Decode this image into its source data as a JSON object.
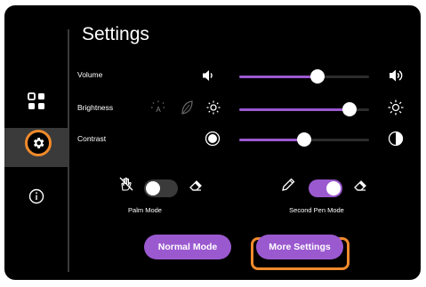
{
  "title": "Settings",
  "sidebar": {
    "items": [
      {
        "name": "apps",
        "icon": "apps-grid-icon"
      },
      {
        "name": "settings",
        "icon": "gear-icon",
        "active": true
      },
      {
        "name": "info",
        "icon": "info-icon"
      }
    ]
  },
  "rows": {
    "volume": {
      "label": "Volume",
      "value": 0.6
    },
    "brightness": {
      "label": "Brightness",
      "value": 0.85
    },
    "contrast": {
      "label": "Contrast",
      "value": 0.5
    }
  },
  "toggles": {
    "palm_mode": {
      "label": "Palm Mode",
      "on": false
    },
    "second_pen_mode": {
      "label": "Second Pen Mode",
      "on": true
    }
  },
  "buttons": {
    "normal_mode": "Normal Mode",
    "more_settings": "More Settings"
  },
  "colors": {
    "accent": "#9b59d0",
    "highlight": "#f08a2c",
    "background": "#000000"
  }
}
